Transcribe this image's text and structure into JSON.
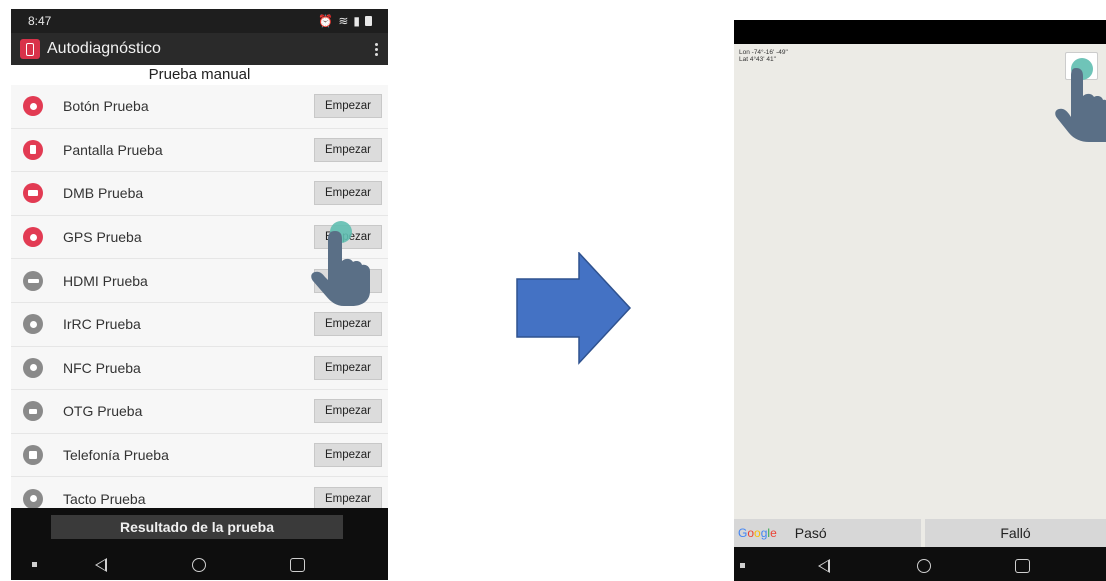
{
  "left_phone": {
    "status_bar": {
      "time": "8:47",
      "right_icons": [
        "alarm-icon",
        "wifi-icon",
        "signal-icon",
        "battery-icon"
      ]
    },
    "app_bar": {
      "title": "Autodiagnóstico",
      "menu_icon": "kebab-menu-icon"
    },
    "section_title": "Prueba manual",
    "tests": [
      {
        "label": "Botón Prueba",
        "button": "Empezar",
        "icon": "button-test-icon",
        "icon_color": "#e23b53"
      },
      {
        "label": "Pantalla Prueba",
        "button": "Empezar",
        "icon": "screen-test-icon",
        "icon_color": "#e23b53"
      },
      {
        "label": "DMB Prueba",
        "button": "Empezar",
        "icon": "dmb-test-icon",
        "icon_color": "#e23b53"
      },
      {
        "label": "GPS Prueba",
        "button": "Empezar",
        "icon": "gps-test-icon",
        "icon_color": "#e23b53"
      },
      {
        "label": "HDMI Prueba",
        "button": "",
        "icon": "hdmi-test-icon",
        "icon_color": "#8a8a8a"
      },
      {
        "label": "IrRC Prueba",
        "button": "Empezar",
        "icon": "irrc-test-icon",
        "icon_color": "#8a8a8a"
      },
      {
        "label": "NFC Prueba",
        "button": "Empezar",
        "icon": "nfc-test-icon",
        "icon_color": "#8a8a8a"
      },
      {
        "label": "OTG Prueba",
        "button": "Empezar",
        "icon": "otg-test-icon",
        "icon_color": "#8a8a8a"
      },
      {
        "label": "Telefonía Prueba",
        "button": "Empezar",
        "icon": "telephony-test-icon",
        "icon_color": "#8a8a8a"
      },
      {
        "label": "Tacto Prueba",
        "button": "Empezar",
        "icon": "touch-test-icon",
        "icon_color": "#8a8a8a"
      }
    ],
    "result_button": "Resultado de la prueba"
  },
  "right_phone": {
    "coords": {
      "lon": "Lon -74°-16' -49\"",
      "lat": "Lat  4°43' 41\""
    },
    "pass_button": "Pasó",
    "fail_button": "Falló",
    "google_logo": "Google"
  },
  "colors": {
    "accent_red": "#e23b53",
    "arrow_blue": "#4472c4",
    "tap_teal": "#5fbeb0",
    "hand": "#5a6f86"
  }
}
